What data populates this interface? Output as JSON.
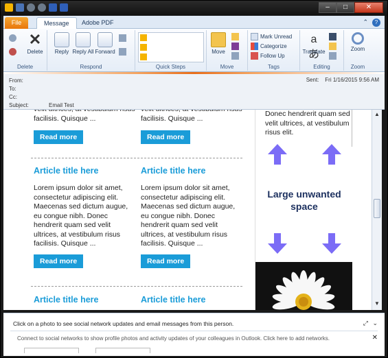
{
  "ribbon": {
    "tabs": [
      "File",
      "Message",
      "Adobe PDF"
    ],
    "groups": {
      "delete": {
        "label": "Delete",
        "delete_btn": "Delete"
      },
      "respond": {
        "label": "Respond",
        "reply": "Reply",
        "reply_all": "Reply All",
        "forward": "Forward"
      },
      "quick_steps": {
        "label": "Quick Steps"
      },
      "move": {
        "label": "Move",
        "move_btn": "Move"
      },
      "tags": {
        "label": "Tags",
        "mark_unread": "Mark Unread",
        "categorize": "Categorize",
        "follow_up": "Follow Up"
      },
      "editing": {
        "label": "Editing",
        "translate": "Translate"
      },
      "zoom": {
        "label": "Zoom",
        "zoom_btn": "Zoom"
      }
    }
  },
  "header": {
    "from_label": "From:",
    "to_label": "To:",
    "cc_label": "Cc:",
    "subject_label": "Subject:",
    "subject": "Email Test",
    "sent_label": "Sent:",
    "sent_value": "Fri 1/16/2015 9:56 AM"
  },
  "email": {
    "top_left_text": "velit ultrices, at vestibulum risus facilisis. Quisque ...",
    "top_right_text": "velit ultrices, at vestibulum risus facilisis. Quisque ...",
    "read_more": "Read more",
    "article_title": "Article title here",
    "article_body": "Lorem ipsum dolor sit amet, consectetur adipiscing elit. Maecenas sed dictum augue, eu congue nibh. Donec hendrerit quam sed velit ultrices, at vestibulum risus facilisis. Quisque ...",
    "aside_top_text": "Donec hendrerit quam sed velit ultrices, at vestibulum risus elit.",
    "aside_callout": "Large unwanted space"
  },
  "people_pane": {
    "title": "Click on a photo to see social network updates and email messages from this person.",
    "connect": "Connect to social networks to show profile photos and activity updates of your colleagues in Outlook. Click here to add networks."
  },
  "colors": {
    "accent": "#1a9cd8",
    "arrow": "#7b6cf6",
    "callout": "#1b2f5e"
  }
}
